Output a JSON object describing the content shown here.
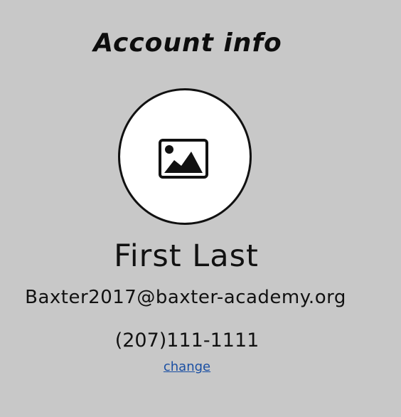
{
  "header": {
    "title": "Account info"
  },
  "profile": {
    "avatar_icon": "image-placeholder-icon",
    "name": "First Last",
    "email": "Baxter2017@baxter-academy.org",
    "phone": "(207)111-1111",
    "change_label": "change"
  },
  "colors": {
    "background": "#c8c8c8",
    "link": "#1a4fa3"
  }
}
